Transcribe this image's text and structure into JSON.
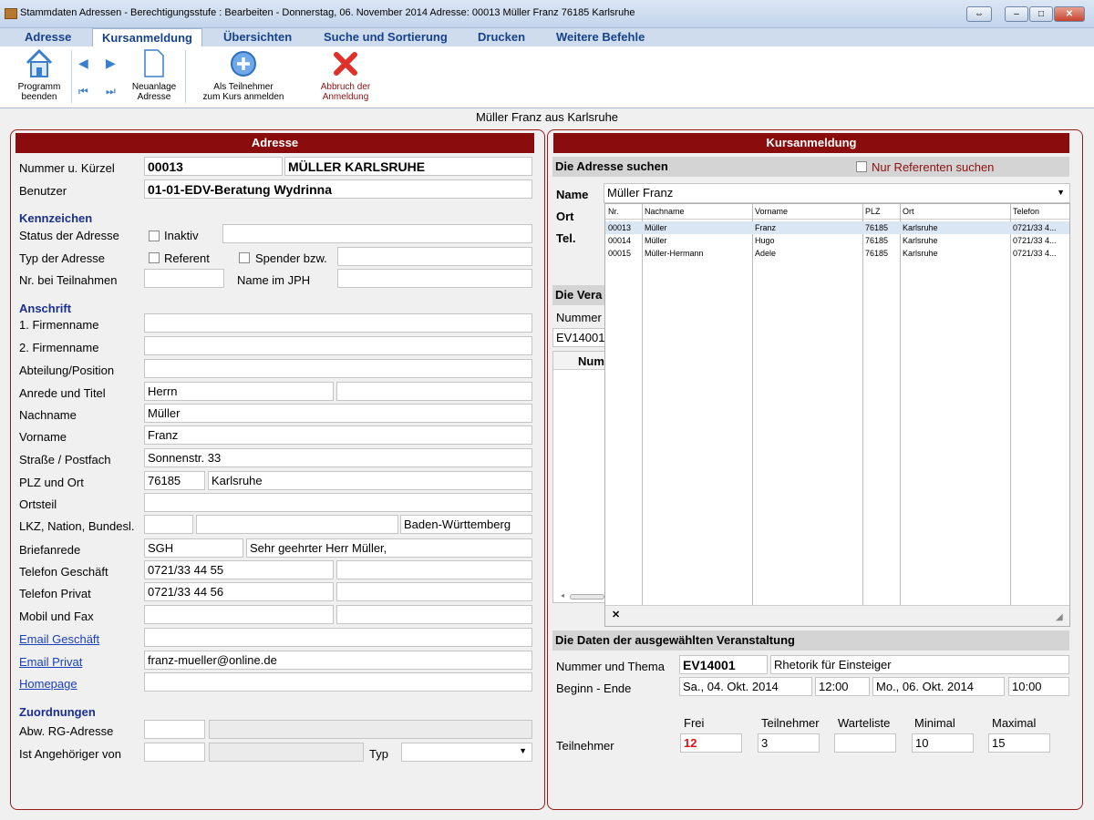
{
  "window": {
    "title": "Stammdaten Adressen - Berechtigungsstufe : Bearbeiten - Donnerstag, 06. November 2014     Adresse: 00013  Müller  Franz  76185  Karlsruhe",
    "btn_restore": "⇔",
    "btn_min": "‒",
    "btn_max": "□",
    "btn_close": "✕"
  },
  "menu": [
    "Adresse",
    "Kursanmeldung",
    "Übersichten",
    "Suche und Sortierung",
    "Drucken",
    "Weitere Befehle"
  ],
  "ribbon": {
    "exit_label": "Programm\nbeenden",
    "new_label": "Neuanlage\nAdresse",
    "register_label": "Als Teilnehmer\nzum Kurs anmelden",
    "cancel_label": "Abbruch der\nAnmeldung"
  },
  "caption": "Müller  Franz aus Karlsruhe",
  "address": {
    "header": "Adresse",
    "nummer_label": "Nummer u. Kürzel",
    "nummer": "00013",
    "kuerzel": "MÜLLER KARLSRUHE",
    "benutzer_label": "Benutzer",
    "benutzer": "01-01-EDV-Beratung Wydrinna",
    "kennzeichen": "Kennzeichen",
    "status_label": "Status der Adresse",
    "inaktiv": "Inaktiv",
    "typ_label": "Typ der Adresse",
    "referent": "Referent",
    "spender": "Spender bzw.",
    "nr_teilnahmen_label": "Nr. bei Teilnahmen",
    "name_jph_label": "Name im JPH",
    "anschrift": "Anschrift",
    "firma1_label": "1. Firmenname",
    "firma2_label": "2. Firmenname",
    "abteilung_label": "Abteilung/Position",
    "anrede_label": "Anrede und Titel",
    "anrede": "Herrn",
    "nachname_label": "Nachname",
    "nachname": "Müller",
    "vorname_label": "Vorname",
    "vorname": "Franz",
    "strasse_label": "Straße / Postfach",
    "strasse": "Sonnenstr. 33",
    "plz_label": "PLZ und Ort",
    "plz": "76185",
    "ort": "Karlsruhe",
    "ortsteil_label": "Ortsteil",
    "lkz_label": "LKZ, Nation, Bundesl.",
    "bundesland": "Baden-Württemberg",
    "briefanrede_label": "Briefanrede",
    "briefanrede_code": "SGH",
    "briefanrede": "Sehr geehrter Herr Müller,",
    "tel_geschaeft_label": "Telefon Geschäft",
    "tel_geschaeft": "0721/33 44 55",
    "tel_privat_label": "Telefon Privat",
    "tel_privat": "0721/33 44 56",
    "mobil_label": "Mobil und Fax",
    "email_geschaeft_label": "Email Geschäft",
    "email_privat_label": "Email Privat",
    "email_privat": "franz-mueller@online.de",
    "homepage_label": "Homepage",
    "zuordnungen": "Zuordnungen",
    "abw_rg_label": "Abw. RG-Adresse",
    "angehoeriger_label": "Ist Angehöriger von",
    "typ_label2": "Typ"
  },
  "course": {
    "header": "Kursanmeldung",
    "search_header": "Die Adresse suchen",
    "nur_referenten": "Nur Referenten suchen",
    "name_label": "Name",
    "name_value": "Müller Franz",
    "ort_label": "Ort",
    "tel_label": "Tel.",
    "hidden_section": "Die Vera",
    "hidden_nummer": "Nummer",
    "hidden_ev": "EV14001",
    "hidden_col": "Num",
    "dropdown_columns": [
      "Nr.",
      "Nachname",
      "Vorname",
      "PLZ",
      "Ort",
      "Telefon"
    ],
    "dropdown_rows": [
      [
        "00013",
        "Müller",
        "Franz",
        "76185",
        "Karlsruhe",
        "0721/33 4..."
      ],
      [
        "00014",
        "Müller",
        "Hugo",
        "76185",
        "Karlsruhe",
        "0721/33 4..."
      ],
      [
        "00015",
        "Müller-Hermann",
        "Adele",
        "76185",
        "Karlsruhe",
        "0721/33 4..."
      ]
    ],
    "dropdown_close": "✕",
    "event_header": "Die Daten der ausgewählten Veranstaltung",
    "thema_label": "Nummer und Thema",
    "event_nr": "EV14001",
    "event_thema": "Rhetorik für Einsteiger",
    "beginn_label": "Beginn - Ende",
    "beginn_date": "Sa., 04. Okt. 2014",
    "beginn_time": "12:00",
    "ende_date": "Mo., 06. Okt. 2014",
    "ende_time": "10:00",
    "teilnehmer_label": "Teilnehmer",
    "col_frei": "Frei",
    "col_teilnehmer": "Teilnehmer",
    "col_warteliste": "Warteliste",
    "col_minimal": "Minimal",
    "col_maximal": "Maximal",
    "frei": "12",
    "teilnehmer": "3",
    "warteliste": "",
    "minimal": "10",
    "maximal": "15"
  },
  "colors": {
    "accent": "#8b0c0c",
    "section": "#1a2f8e",
    "menu": "#15428b"
  }
}
